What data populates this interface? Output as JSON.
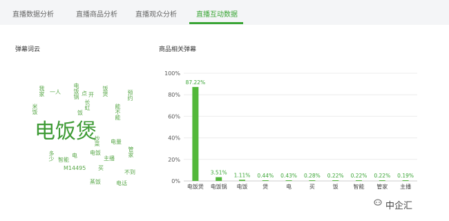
{
  "tabs": [
    {
      "label": "直播数据分析",
      "active": false
    },
    {
      "label": "直播商品分析",
      "active": false
    },
    {
      "label": "直播观众分析",
      "active": false
    },
    {
      "label": "直播互动数据",
      "active": true
    }
  ],
  "left_section": {
    "title": "弹幕词云"
  },
  "right_section": {
    "title": "商品相关弹幕"
  },
  "word_cloud": {
    "words": [
      "电饭煲",
      "一人",
      "电饭锅",
      "饭",
      "电",
      "买",
      "管家",
      "主播",
      "智能",
      "电话",
      "不到",
      "M14495",
      "预约",
      "米饭",
      "电饭",
      "饭煲",
      "开",
      "点",
      "长虹",
      "炒菜",
      "多少",
      "电量",
      "蒸饭",
      "能不能",
      "我家"
    ]
  },
  "chart_data": {
    "type": "bar",
    "title": "",
    "categories": [
      "电饭煲",
      "电饭锅",
      "电饭",
      "煲",
      "电",
      "买",
      "饭",
      "智能",
      "管家",
      "主播"
    ],
    "values": [
      87.22,
      3.51,
      1.11,
      0.44,
      0.43,
      0.28,
      0.22,
      0.22,
      0.22,
      0.19
    ],
    "value_labels": [
      "87.22%",
      "3.51%",
      "1.11%",
      "0.44%",
      "0.43%",
      "0.28%",
      "0.22%",
      "0.22%",
      "0.22%",
      "0.19%"
    ],
    "y_ticks": [
      "0%",
      "20%",
      "40%",
      "60%",
      "80%",
      "100%"
    ],
    "y_tick_values": [
      0,
      20,
      40,
      60,
      80,
      100
    ],
    "ylim": [
      0,
      100
    ],
    "grid": true,
    "bar_color": "#52b83a"
  },
  "watermark": {
    "text": "中企汇"
  }
}
